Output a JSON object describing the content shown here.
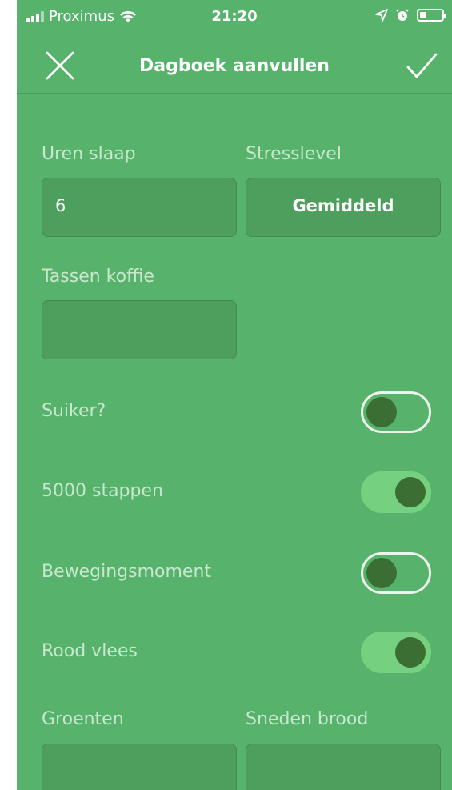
{
  "status_bar": {
    "carrier": "Proximus",
    "time": "21:20"
  },
  "nav": {
    "title": "Dagboek aanvullen",
    "close_icon": "close-icon",
    "confirm_icon": "checkmark-icon"
  },
  "form": {
    "uren_slaap": {
      "label": "Uren slaap",
      "value": "6"
    },
    "stresslevel": {
      "label": "Stresslevel",
      "value": "Gemiddeld"
    },
    "tassen_koffie": {
      "label": "Tassen koffie",
      "value": ""
    },
    "toggles": [
      {
        "label": "Suiker?",
        "on": false
      },
      {
        "label": "5000 stappen",
        "on": true
      },
      {
        "label": "Bewegingsmoment",
        "on": false
      },
      {
        "label": "Rood vlees",
        "on": true
      }
    ],
    "groenten": {
      "label": "Groenten",
      "value": ""
    },
    "sneden_brood": {
      "label": "Sneden brood",
      "value": ""
    }
  },
  "colors": {
    "background": "#57b36b",
    "field": "#4e9f5e",
    "toggle_on": "#75d17f",
    "knob": "#3a6e33",
    "label": "#c9e7cf"
  }
}
